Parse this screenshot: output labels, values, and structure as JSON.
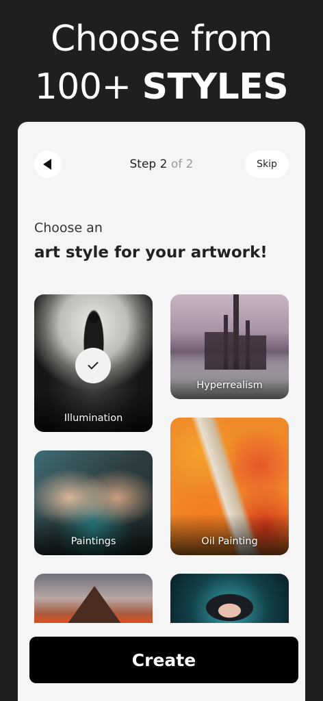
{
  "headline": {
    "line1": "Choose from",
    "line2_number": "100+",
    "line2_bold": "STYLES"
  },
  "nav": {
    "back_icon": "back-triangle-icon",
    "step_label": "Step",
    "step_current": "2",
    "step_of": "of 2",
    "skip_label": "Skip"
  },
  "prompt": {
    "subtitle": "Choose an",
    "title": "art style for your artwork!"
  },
  "styles": [
    {
      "label": "Illumination",
      "selected": true
    },
    {
      "label": "Hyperrealism",
      "selected": false
    },
    {
      "label": "Paintings",
      "selected": false
    },
    {
      "label": "Oil Painting",
      "selected": false
    },
    {
      "label": "",
      "selected": false
    },
    {
      "label": "",
      "selected": false
    }
  ],
  "create_label": "Create",
  "colors": {
    "background": "#1f1f1f",
    "card": "#f4f5f4",
    "primary_button": "#000000"
  }
}
